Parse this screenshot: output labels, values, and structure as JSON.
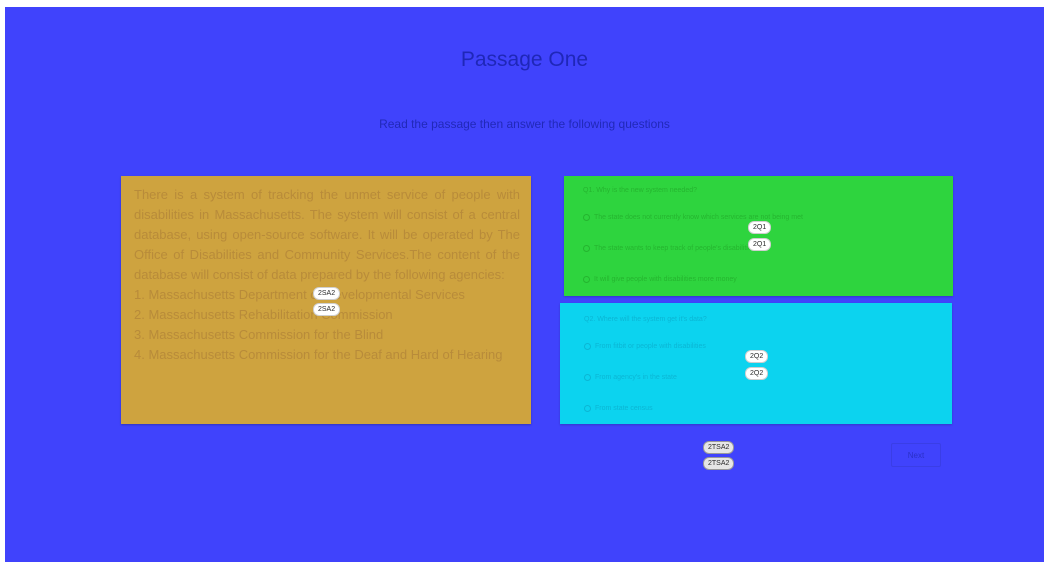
{
  "page": {
    "title": "Passage One",
    "subtitle": "Read the passage then answer the following questions"
  },
  "passage": {
    "text": "There is a system of tracking the unmet service of people with disabilities in Massachusetts. The system will consist of a central database, using open-source software. It will be operated by The Office of Disabilities and Community Services.The content of the database will consist of data prepared by the following agencies:",
    "items": [
      "1. Massachusetts Department of Developmental Services",
      "2. Massachusetts Rehabilitation Commission",
      "3. Massachusetts Commission for the Blind",
      "4. Massachusetts Commission for the Deaf and Hard of Hearing"
    ],
    "tag": "2SA2"
  },
  "question1": {
    "text": "Q1. Why is the new system needed?",
    "options": [
      "The state does not currently know which services are not being met",
      "The state wants to keep track of people's disabilities",
      "It will give people with disabilities more money"
    ],
    "tag": "2Q1"
  },
  "question2": {
    "text": "Q2. Where will the system get it's data?",
    "options": [
      "From fitbit or people with disabilities",
      "From agency's in the state",
      "From state census"
    ],
    "tag": "2Q2"
  },
  "footer": {
    "tag": "2TSA2",
    "next_label": "Next"
  },
  "colors": {
    "background": "#4043fc",
    "passage": "#cea33f",
    "question1": "#2ed43e",
    "question2": "#0cd3ef"
  }
}
